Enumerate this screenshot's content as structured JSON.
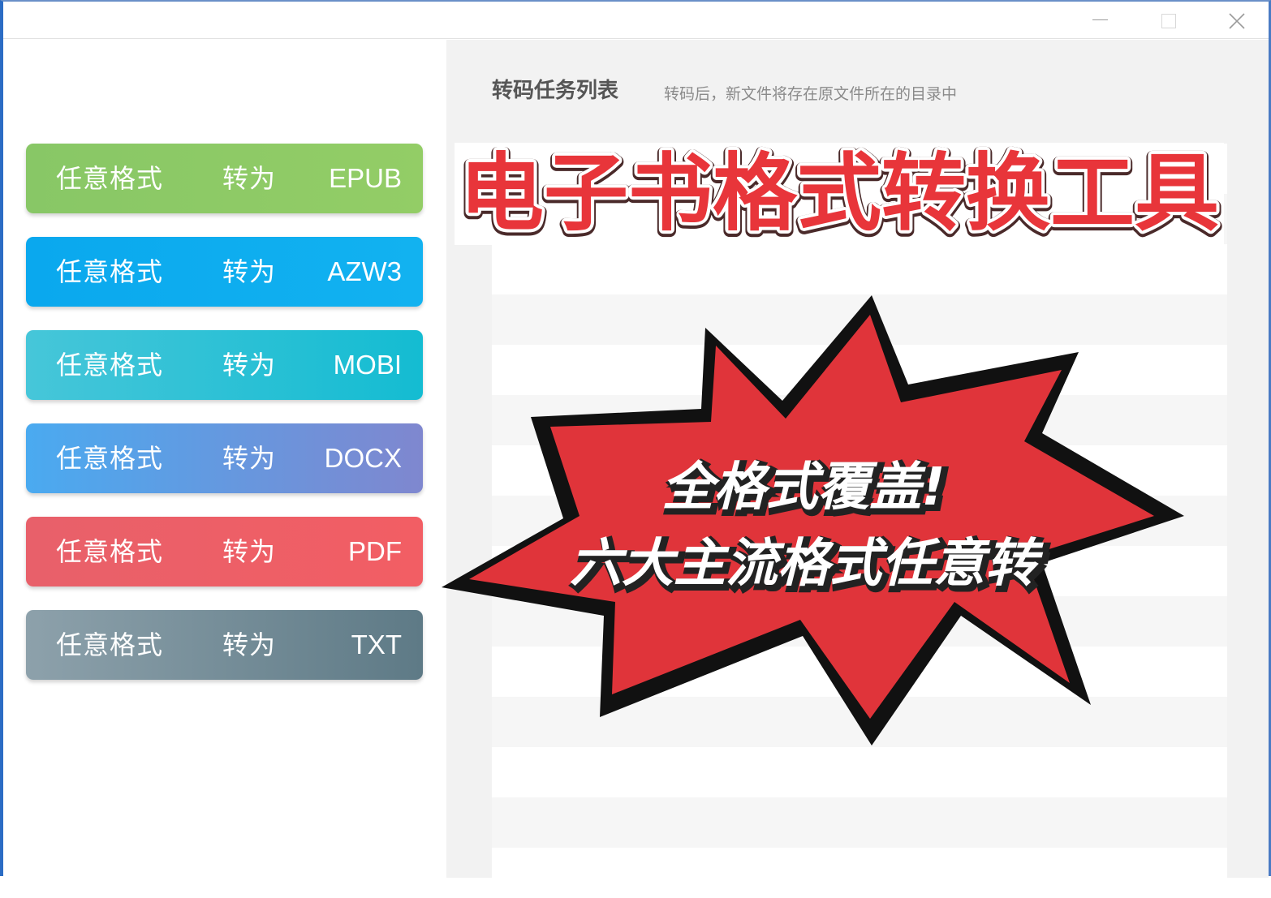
{
  "window": {
    "controls": [
      "minimize",
      "maximize",
      "close"
    ]
  },
  "sidebar": {
    "buttons": [
      {
        "any_label": "任意格式",
        "to_label": "转为",
        "format": "EPUB",
        "color_from": "#88c766",
        "color_to": "#93cd66"
      },
      {
        "any_label": "任意格式",
        "to_label": "转为",
        "format": "AZW3",
        "color_from": "#0aa8ee",
        "color_to": "#12b2f0"
      },
      {
        "any_label": "任意格式",
        "to_label": "转为",
        "format": "MOBI",
        "color_from": "#46c6d9",
        "color_to": "#14bcd2"
      },
      {
        "any_label": "任意格式",
        "to_label": "转为",
        "format": "DOCX",
        "color_from": "#4aaaf0",
        "color_to": "#7f87cf"
      },
      {
        "any_label": "任意格式",
        "to_label": "转为",
        "format": "PDF",
        "color_from": "#e8606a",
        "color_to": "#f25e64"
      },
      {
        "any_label": "任意格式",
        "to_label": "转为",
        "format": "TXT",
        "color_from": "#8da1ab",
        "color_to": "#5e7a86"
      }
    ]
  },
  "main": {
    "title": "转码任务列表",
    "hint": "转码后，新文件将存在原文件所在的目录中"
  },
  "overlay": {
    "banner_text": "电子书格式转换工具",
    "burst_line1": "全格式覆盖!",
    "burst_line2": "六大主流格式任意转",
    "banner_color": "#e8353a",
    "burst_color": "#e0343a"
  }
}
